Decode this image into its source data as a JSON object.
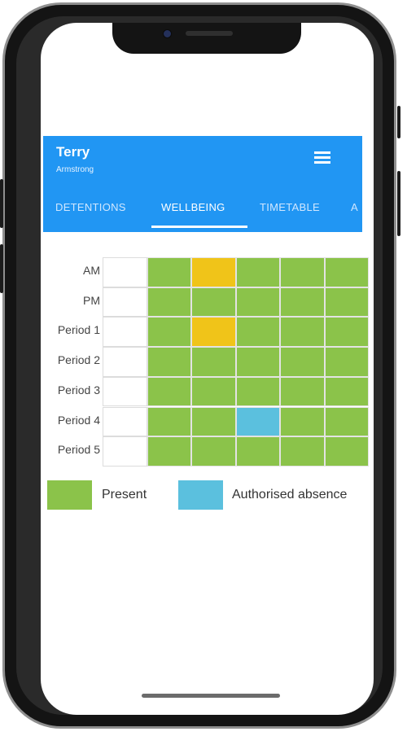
{
  "header": {
    "student_name": "Terry",
    "student_subtitle": "Armstrong"
  },
  "tabs": [
    {
      "label": "DETENTIONS",
      "active": false
    },
    {
      "label": "WELLBEING",
      "active": true
    },
    {
      "label": "TIMETABLE",
      "active": false
    },
    {
      "label": "A",
      "active": false
    }
  ],
  "attendance": {
    "rows": [
      "AM",
      "PM",
      "Period 1",
      "Period 2",
      "Period 3",
      "Period 4",
      "Period 5"
    ],
    "columns_count": 6,
    "cells": [
      [
        "blank",
        "present",
        "late",
        "present",
        "present",
        "present"
      ],
      [
        "blank",
        "present",
        "present",
        "present",
        "present",
        "present"
      ],
      [
        "blank",
        "present",
        "late",
        "present",
        "present",
        "present"
      ],
      [
        "blank",
        "present",
        "present",
        "present",
        "present",
        "present"
      ],
      [
        "blank",
        "present",
        "present",
        "present",
        "present",
        "present"
      ],
      [
        "blank",
        "present",
        "present",
        "authorised",
        "present",
        "present"
      ],
      [
        "blank",
        "present",
        "present",
        "present",
        "present",
        "present"
      ]
    ]
  },
  "legend": [
    {
      "label": "Present",
      "color": "#8bc34a"
    },
    {
      "label": "Authorised absence",
      "color": "#5bc0de"
    }
  ],
  "colors": {
    "present": "#8bc34a",
    "late": "#f0c419",
    "authorised": "#5bc0de",
    "app_bar": "#2196f3"
  },
  "icons": {
    "menu": "hamburger-menu-icon"
  }
}
